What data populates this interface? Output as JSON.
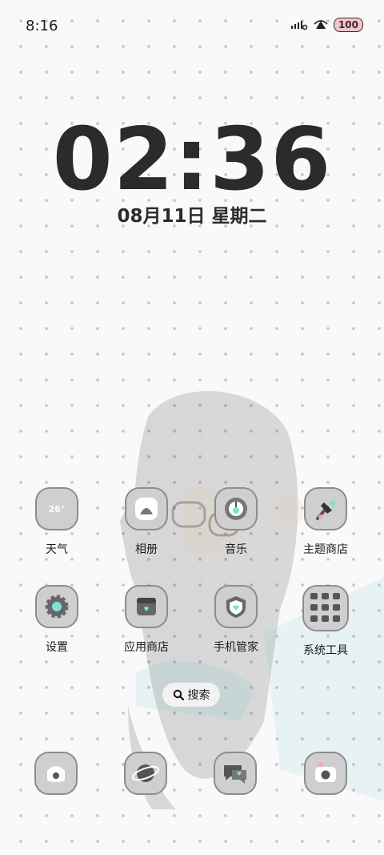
{
  "status_bar": {
    "time": "8:16",
    "battery": "100",
    "icons": [
      "signal-icon",
      "wifi-icon",
      "battery-icon"
    ]
  },
  "lockscreen": {
    "clock": "02:36",
    "date": "08月11日 星期二"
  },
  "apps": [
    {
      "label": "天气",
      "icon": "weather-icon",
      "icon_text": "26°"
    },
    {
      "label": "相册",
      "icon": "gallery-icon"
    },
    {
      "label": "音乐",
      "icon": "music-icon"
    },
    {
      "label": "主题商店",
      "icon": "theme-store-icon"
    },
    {
      "label": "设置",
      "icon": "settings-icon"
    },
    {
      "label": "应用商店",
      "icon": "app-store-icon"
    },
    {
      "label": "手机管家",
      "icon": "phone-manager-icon"
    },
    {
      "label": "系统工具",
      "icon": "system-tools-folder-icon"
    }
  ],
  "search": {
    "label": "搜索",
    "icon": "search-icon"
  },
  "dock": [
    {
      "icon": "phone-icon"
    },
    {
      "icon": "browser-icon"
    },
    {
      "icon": "messages-icon"
    },
    {
      "icon": "camera-icon"
    }
  ],
  "colors": {
    "accent": "#7fe0d8",
    "icon_bg": "#cfcfcf",
    "text": "#2b2b2b"
  }
}
